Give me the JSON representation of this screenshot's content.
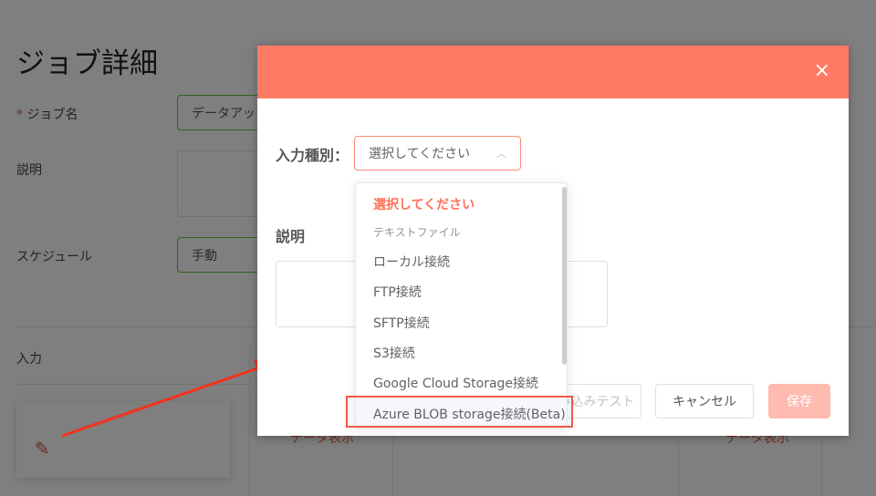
{
  "page": {
    "title": "ジョブ詳細",
    "job_name_label": "ジョブ名",
    "required_mark": "*",
    "job_name_value": "データアップ",
    "description_label": "説明",
    "schedule_label": "スケジュール",
    "schedule_value": "手動",
    "input_label": "入力",
    "data_view_left": "データ表示",
    "data_view_right": "データ表示"
  },
  "modal": {
    "close": "×",
    "input_type_label": "入力種別：",
    "select_value": "選択してください",
    "description_label": "説明",
    "buttons": {
      "test": "読み込みテスト",
      "cancel": "キャンセル",
      "save": "保存"
    }
  },
  "dropdown": {
    "options": [
      {
        "label": "選択してください",
        "state": "selected"
      },
      {
        "label": "テキストファイル",
        "state": "group"
      },
      {
        "label": "ローカル接続"
      },
      {
        "label": "FTP接続"
      },
      {
        "label": "SFTP接続"
      },
      {
        "label": "S3接続"
      },
      {
        "label": "Google Cloud Storage接続"
      },
      {
        "label": "Azure BLOB storage接続(Beta)",
        "state": "hover"
      }
    ]
  },
  "colors": {
    "accent": "#ff7a62",
    "save_disabled": "#ffbbaf",
    "highlight": "#f25a42",
    "valid_border": "#67c23a"
  }
}
